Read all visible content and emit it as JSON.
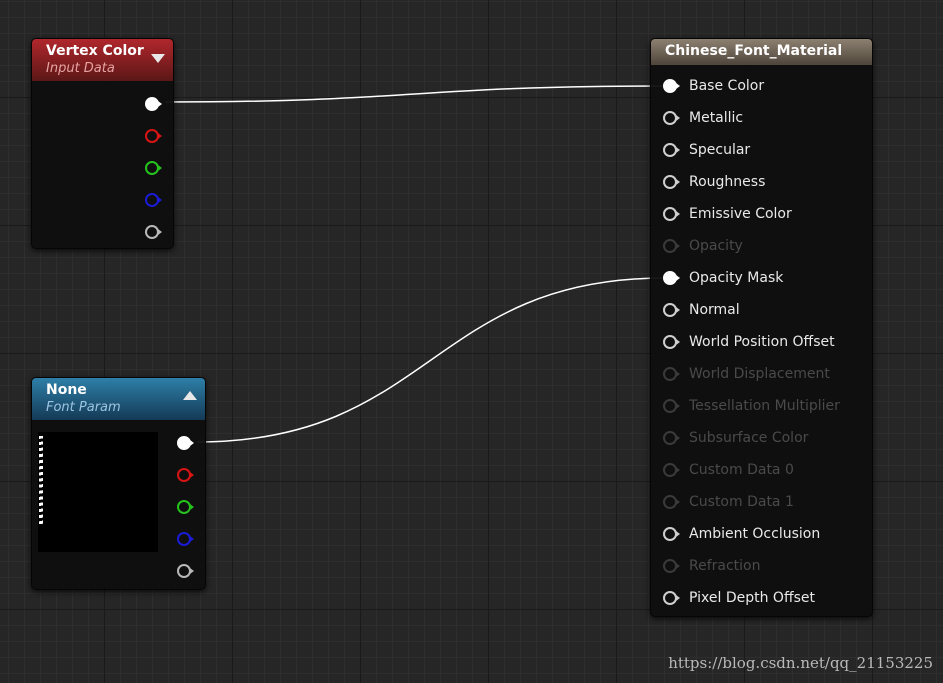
{
  "graph": {
    "nodes": {
      "vertex_color": {
        "title": "Vertex Color",
        "subtitle": "Input Data",
        "outputs": [
          "white",
          "red",
          "green",
          "blue",
          "gray"
        ]
      },
      "font_param": {
        "title": "None",
        "subtitle": "Font Param",
        "outputs": [
          "white",
          "red",
          "green",
          "blue",
          "gray"
        ]
      },
      "material": {
        "title": "Chinese_Font_Material",
        "inputs": [
          {
            "label": "Base Color",
            "enabled": true,
            "connected": true
          },
          {
            "label": "Metallic",
            "enabled": true,
            "connected": false
          },
          {
            "label": "Specular",
            "enabled": true,
            "connected": false
          },
          {
            "label": "Roughness",
            "enabled": true,
            "connected": false
          },
          {
            "label": "Emissive Color",
            "enabled": true,
            "connected": false
          },
          {
            "label": "Opacity",
            "enabled": false,
            "connected": false
          },
          {
            "label": "Opacity Mask",
            "enabled": true,
            "connected": true
          },
          {
            "label": "Normal",
            "enabled": true,
            "connected": false
          },
          {
            "label": "World Position Offset",
            "enabled": true,
            "connected": false
          },
          {
            "label": "World Displacement",
            "enabled": false,
            "connected": false
          },
          {
            "label": "Tessellation Multiplier",
            "enabled": false,
            "connected": false
          },
          {
            "label": "Subsurface Color",
            "enabled": false,
            "connected": false
          },
          {
            "label": "Custom Data 0",
            "enabled": false,
            "connected": false
          },
          {
            "label": "Custom Data 1",
            "enabled": false,
            "connected": false
          },
          {
            "label": "Ambient Occlusion",
            "enabled": true,
            "connected": false
          },
          {
            "label": "Refraction",
            "enabled": false,
            "connected": false
          },
          {
            "label": "Pixel Depth Offset",
            "enabled": true,
            "connected": false
          }
        ]
      }
    },
    "connections": [
      {
        "from": "vertex_color.output_0",
        "to": "material.Base Color"
      },
      {
        "from": "font_param.output_0",
        "to": "material.Opacity Mask"
      }
    ],
    "colors": {
      "wire": "#ffffff",
      "vertex_header": "#b0272c",
      "param_header": "#2e7fa8",
      "material_header": "#8c8070"
    }
  },
  "watermark": "https://blog.csdn.net/qq_21153225"
}
